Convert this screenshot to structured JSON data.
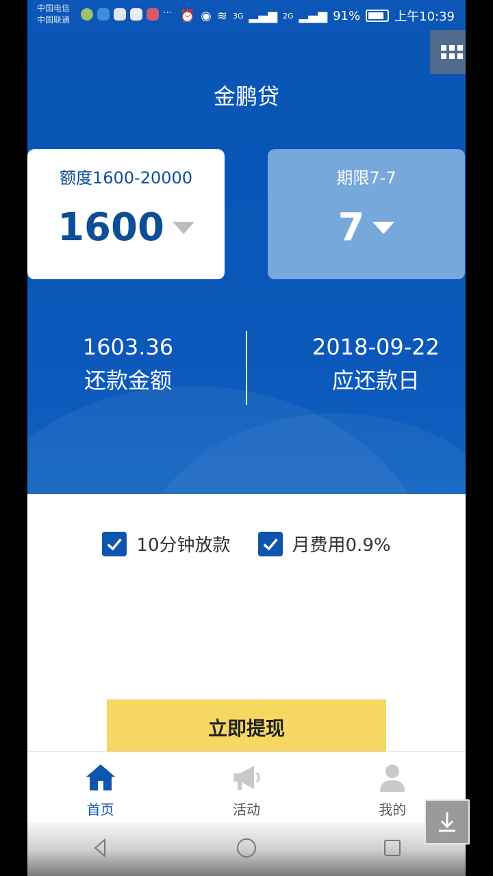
{
  "status_bar": {
    "carrier_1": "中国电信",
    "carrier_2": "中国联通",
    "signal_1": "3G",
    "signal_2": "2G",
    "battery": "91%",
    "time": "上午10:39"
  },
  "header": {
    "title": "金鹏贷"
  },
  "amount_card": {
    "label": "额度1600-20000",
    "value": "1600"
  },
  "term_card": {
    "label": "期限7-7",
    "value": "7"
  },
  "stats": {
    "repay_amount": "1603.36",
    "repay_amount_label": "还款金额",
    "due_date": "2018-09-22",
    "due_date_label": "应还款日"
  },
  "options": [
    {
      "label": "10分钟放款",
      "checked": true
    },
    {
      "label": "月费用0.9%",
      "checked": true
    }
  ],
  "cta": {
    "label": "立即提现"
  },
  "tabs": [
    {
      "label": "首页",
      "icon": "home-icon",
      "active": true
    },
    {
      "label": "活动",
      "icon": "megaphone-icon",
      "active": false
    },
    {
      "label": "我的",
      "icon": "user-icon",
      "active": false
    }
  ],
  "colors": {
    "primary": "#0b56b6",
    "cta": "#f5d762",
    "term_card": "#76a8db"
  }
}
